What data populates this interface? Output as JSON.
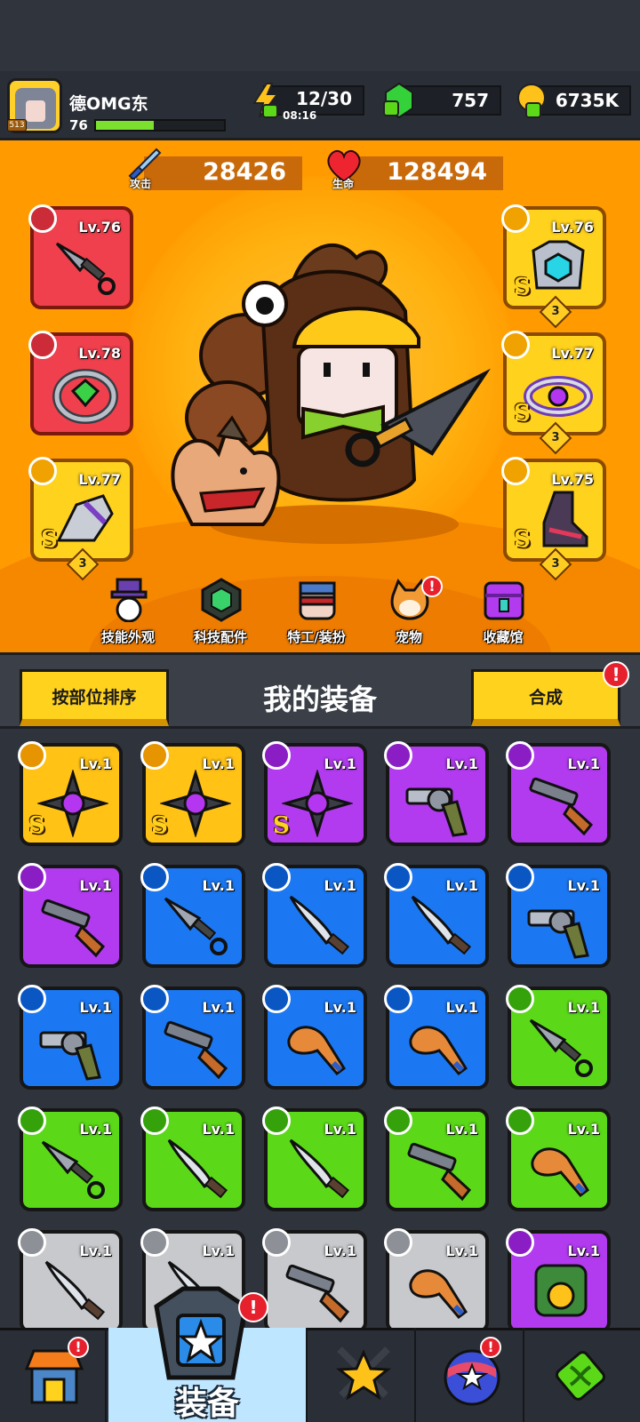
{
  "player": {
    "name": "德OMG东",
    "level": "76",
    "badge": "513",
    "xp_fraction": 0.45
  },
  "resources": {
    "energy": "12/30",
    "energy_timer": "08:16",
    "gems": "757",
    "gold": "6735K"
  },
  "stats": {
    "attack_label": "攻击",
    "attack_value": "28426",
    "hp_label": "生命",
    "hp_value": "128494"
  },
  "left_slots": [
    {
      "name": "weapon",
      "level": "Lv.76",
      "icon": "kunai-icon",
      "rarity": "red"
    },
    {
      "name": "ring",
      "level": "Lv.78",
      "icon": "ring-icon",
      "rarity": "red"
    },
    {
      "name": "glove",
      "level": "Lv.77",
      "icon": "gauntlet-icon",
      "rarity": "gold",
      "grade": "S",
      "stars": "3"
    }
  ],
  "right_slots": [
    {
      "name": "armor",
      "level": "Lv.76",
      "icon": "armor-icon",
      "rarity": "gold",
      "grade": "S",
      "stars": "3"
    },
    {
      "name": "belt",
      "level": "Lv.77",
      "icon": "belt-icon",
      "rarity": "gold",
      "grade": "S",
      "stars": "3"
    },
    {
      "name": "boots",
      "level": "Lv.75",
      "icon": "boots-icon",
      "rarity": "gold",
      "grade": "S",
      "stars": "3"
    }
  ],
  "menu": [
    {
      "label": "技能外观",
      "icon": "skill-skin-icon"
    },
    {
      "label": "科技配件",
      "icon": "tech-part-icon"
    },
    {
      "label": "特工/装扮",
      "icon": "agent-icon"
    },
    {
      "label": "宠物",
      "icon": "pet-icon",
      "alert": "!"
    },
    {
      "label": "收藏馆",
      "icon": "collection-icon"
    }
  ],
  "inventory": {
    "sort_label": "按部位排序",
    "title": "我的装备",
    "merge_label": "合成",
    "merge_alert": "!",
    "items": [
      {
        "rarity": "gold",
        "level": "Lv.1",
        "icon": "shuriken-icon",
        "grade": "S"
      },
      {
        "rarity": "gold",
        "level": "Lv.1",
        "icon": "shuriken-icon",
        "grade": "S"
      },
      {
        "rarity": "purple",
        "level": "Lv.1",
        "icon": "shuriken-icon",
        "grade": "S"
      },
      {
        "rarity": "purple",
        "level": "Lv.1",
        "icon": "revolver-icon"
      },
      {
        "rarity": "purple",
        "level": "Lv.1",
        "icon": "shotgun-icon"
      },
      {
        "rarity": "purple",
        "level": "Lv.1",
        "icon": "shotgun-icon"
      },
      {
        "rarity": "blue",
        "level": "Lv.1",
        "icon": "kunai-icon"
      },
      {
        "rarity": "blue",
        "level": "Lv.1",
        "icon": "machete-icon"
      },
      {
        "rarity": "blue",
        "level": "Lv.1",
        "icon": "machete-icon"
      },
      {
        "rarity": "blue",
        "level": "Lv.1",
        "icon": "revolver-icon"
      },
      {
        "rarity": "blue",
        "level": "Lv.1",
        "icon": "revolver-icon"
      },
      {
        "rarity": "blue",
        "level": "Lv.1",
        "icon": "shotgun-icon"
      },
      {
        "rarity": "blue",
        "level": "Lv.1",
        "icon": "bat-icon"
      },
      {
        "rarity": "blue",
        "level": "Lv.1",
        "icon": "bat-icon"
      },
      {
        "rarity": "green",
        "level": "Lv.1",
        "icon": "kunai-icon"
      },
      {
        "rarity": "green",
        "level": "Lv.1",
        "icon": "kunai-icon"
      },
      {
        "rarity": "green",
        "level": "Lv.1",
        "icon": "machete-icon"
      },
      {
        "rarity": "green",
        "level": "Lv.1",
        "icon": "machete-icon"
      },
      {
        "rarity": "green",
        "level": "Lv.1",
        "icon": "shotgun-icon"
      },
      {
        "rarity": "green",
        "level": "Lv.1",
        "icon": "bat-icon"
      },
      {
        "rarity": "gray",
        "level": "Lv.1",
        "icon": "machete-icon"
      },
      {
        "rarity": "gray",
        "level": "Lv.1",
        "icon": "machete-icon"
      },
      {
        "rarity": "gray",
        "level": "Lv.1",
        "icon": "shotgun-icon"
      },
      {
        "rarity": "gray",
        "level": "Lv.1",
        "icon": "bat-icon"
      },
      {
        "rarity": "purple",
        "level": "Lv.1",
        "icon": "armor-icon"
      }
    ]
  },
  "bottom_nav": [
    {
      "name": "shop",
      "icon": "shop-icon",
      "alert": "!"
    },
    {
      "name": "equipment",
      "icon": "equipment-icon",
      "label": "装备",
      "alert": "!",
      "active": true
    },
    {
      "name": "battle",
      "icon": "battle-star-icon"
    },
    {
      "name": "events",
      "icon": "event-ball-icon",
      "alert": "!"
    },
    {
      "name": "lab",
      "icon": "dna-icon"
    }
  ],
  "colors": {
    "arena": "#ff9a00",
    "red_rarity": "#f0404d",
    "gold_rarity": "#ffc215",
    "purple_rarity": "#b23bf0",
    "blue_rarity": "#1b78f2",
    "green_rarity": "#5bd919",
    "gray_rarity": "#c7c9cc",
    "button_yellow": "#ffd21e",
    "alert_red": "#e7202e"
  }
}
